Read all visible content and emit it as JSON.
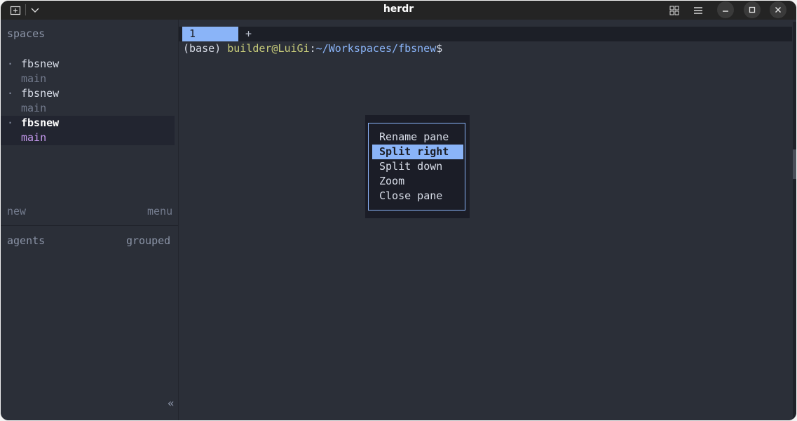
{
  "window": {
    "title": "herdr",
    "new_tab_icon": "new-tab-icon",
    "dropdown_icon": "chevron-down-icon",
    "controls": [
      "grid-icon",
      "menu-icon",
      "minimize-icon",
      "maximize-icon",
      "close-icon"
    ]
  },
  "sidebar": {
    "spaces_header": "spaces",
    "spaces": [
      {
        "bullet": "·",
        "name": "fbsnew",
        "branch": "main",
        "selected": false
      },
      {
        "bullet": "·",
        "name": "fbsnew",
        "branch": "main",
        "selected": false
      },
      {
        "bullet": "·",
        "name": "fbsnew",
        "branch": "main",
        "selected": true
      }
    ],
    "new_label": "new",
    "menu_label": "menu",
    "agents_label": "agents",
    "grouped_label": "grouped",
    "collapse_glyph": "«"
  },
  "tabs": {
    "active": "1",
    "add": "+"
  },
  "terminal": {
    "env": "(base)",
    "user_host": "builder@LuiGi",
    "sep": ":",
    "path": "~/Workspaces/fbsnew",
    "symbol": "$"
  },
  "context_menu": {
    "items": [
      "Rename pane",
      "Split right",
      "Split down",
      "Zoom",
      "Close pane"
    ],
    "selected_index": 1
  },
  "colors": {
    "accent": "#8ab4f8",
    "user_host": "#c8cc7a",
    "path": "#8ab4f8",
    "branch_selected": "#c79af0"
  }
}
